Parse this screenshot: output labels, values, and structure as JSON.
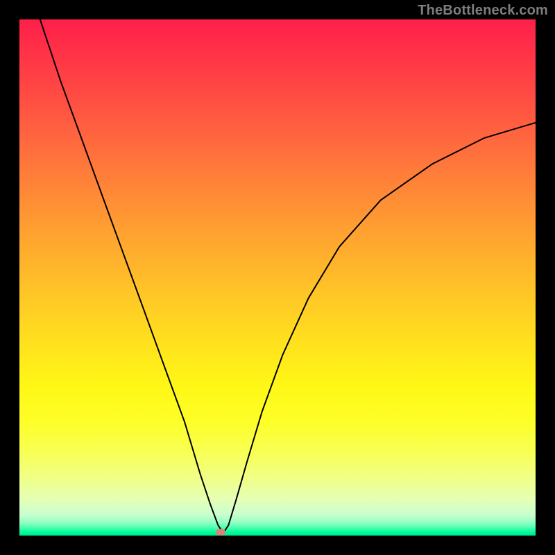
{
  "watermark": "TheBottleneck.com",
  "marker": {
    "color": "#e17f7b",
    "x_pct": 39.0,
    "y_pct": 99.3
  },
  "chart_data": {
    "type": "line",
    "title": "",
    "xlabel": "",
    "ylabel": "",
    "xlim": [
      0,
      100
    ],
    "ylim": [
      0,
      100
    ],
    "grid": false,
    "legend": false,
    "series": [
      {
        "name": "bottleneck-curve",
        "x": [
          4,
          8,
          12,
          16,
          20,
          24,
          28,
          32,
          35,
          37,
          38.5,
          39.5,
          40.5,
          42,
          44,
          47,
          51,
          56,
          62,
          70,
          80,
          90,
          100
        ],
        "y": [
          100,
          88,
          77,
          66,
          55,
          44,
          33,
          22,
          12,
          6,
          2,
          0.5,
          2,
          7,
          14,
          24,
          35,
          46,
          56,
          65,
          72,
          77,
          80
        ]
      }
    ],
    "optimal_x": 39,
    "gradient_stops": [
      {
        "pct": 0,
        "color": "#ff1f4a"
      },
      {
        "pct": 50,
        "color": "#ffd022"
      },
      {
        "pct": 80,
        "color": "#fbff3a"
      },
      {
        "pct": 100,
        "color": "#00e890"
      }
    ]
  }
}
